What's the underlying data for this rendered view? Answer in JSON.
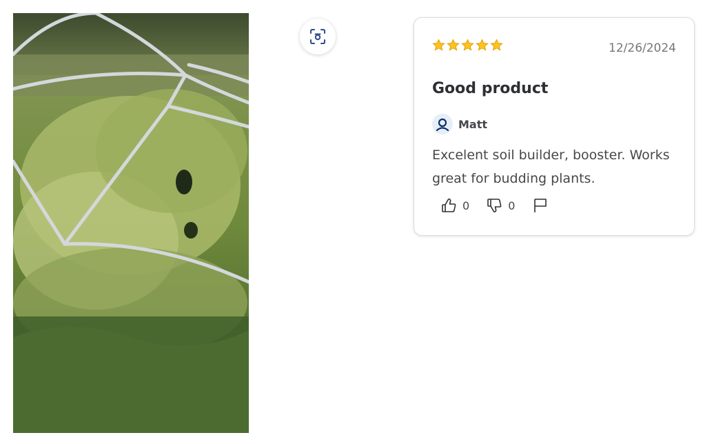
{
  "photo": {
    "description_icon": "review-photo"
  },
  "visual_search": {
    "icon": "camera-scan-icon"
  },
  "review": {
    "rating": 5,
    "rating_max": 5,
    "date": "12/26/2024",
    "title": "Good product",
    "author": "Matt",
    "body": "Excelent soil builder, booster. Works great for budding plants.",
    "helpful_count": "0",
    "not_helpful_count": "0",
    "icons": {
      "helpful": "thumbs-up-icon",
      "not_helpful": "thumbs-down-icon",
      "report": "flag-icon",
      "avatar": "user-icon"
    }
  },
  "colors": {
    "star": "#ffc220",
    "star_outline": "#e0a000",
    "avatar_bg": "#e6eef8",
    "avatar_icon": "#0c2f6b"
  }
}
